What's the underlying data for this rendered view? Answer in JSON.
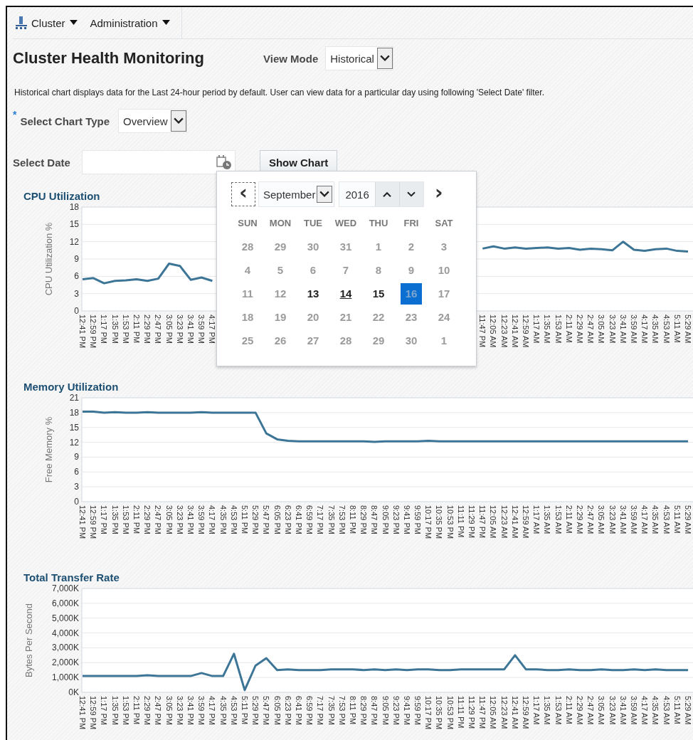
{
  "menu": [
    {
      "label": "Cluster"
    },
    {
      "label": "Administration"
    }
  ],
  "title": "Cluster Health Monitoring",
  "view_mode": {
    "label": "View Mode",
    "value": "Historical"
  },
  "description": "Historical chart displays data for the Last 24-hour period by default. User can view data for a particular day using following 'Select Date' filter.",
  "chart_type": {
    "label": "Select Chart Type",
    "required_mark": "*",
    "value": "Overview"
  },
  "select_date": {
    "label": "Select Date"
  },
  "show_chart_button": "Show Chart",
  "date_picker": {
    "prev": "‹",
    "next": "›",
    "month": "September",
    "year": "2016",
    "weekdays": [
      "SUN",
      "MON",
      "TUE",
      "WED",
      "THU",
      "FRI",
      "SAT"
    ],
    "days": [
      {
        "label": "28",
        "enabled": false,
        "selected": false,
        "hovered": false
      },
      {
        "label": "29",
        "enabled": false,
        "selected": false,
        "hovered": false
      },
      {
        "label": "30",
        "enabled": false,
        "selected": false,
        "hovered": false
      },
      {
        "label": "31",
        "enabled": false,
        "selected": false,
        "hovered": false
      },
      {
        "label": "1",
        "enabled": false,
        "selected": false,
        "hovered": false
      },
      {
        "label": "2",
        "enabled": false,
        "selected": false,
        "hovered": false
      },
      {
        "label": "3",
        "enabled": false,
        "selected": false,
        "hovered": false
      },
      {
        "label": "4",
        "enabled": false,
        "selected": false,
        "hovered": false
      },
      {
        "label": "5",
        "enabled": false,
        "selected": false,
        "hovered": false
      },
      {
        "label": "6",
        "enabled": false,
        "selected": false,
        "hovered": false
      },
      {
        "label": "7",
        "enabled": false,
        "selected": false,
        "hovered": false
      },
      {
        "label": "8",
        "enabled": false,
        "selected": false,
        "hovered": false
      },
      {
        "label": "9",
        "enabled": false,
        "selected": false,
        "hovered": false
      },
      {
        "label": "10",
        "enabled": false,
        "selected": false,
        "hovered": false
      },
      {
        "label": "11",
        "enabled": false,
        "selected": false,
        "hovered": false
      },
      {
        "label": "12",
        "enabled": false,
        "selected": false,
        "hovered": false
      },
      {
        "label": "13",
        "enabled": true,
        "selected": false,
        "hovered": false
      },
      {
        "label": "14",
        "enabled": true,
        "selected": false,
        "hovered": true
      },
      {
        "label": "15",
        "enabled": true,
        "selected": false,
        "hovered": false
      },
      {
        "label": "16",
        "enabled": false,
        "selected": true,
        "hovered": false
      },
      {
        "label": "17",
        "enabled": false,
        "selected": false,
        "hovered": false
      },
      {
        "label": "18",
        "enabled": false,
        "selected": false,
        "hovered": false
      },
      {
        "label": "19",
        "enabled": false,
        "selected": false,
        "hovered": false
      },
      {
        "label": "20",
        "enabled": false,
        "selected": false,
        "hovered": false
      },
      {
        "label": "21",
        "enabled": false,
        "selected": false,
        "hovered": false
      },
      {
        "label": "22",
        "enabled": false,
        "selected": false,
        "hovered": false
      },
      {
        "label": "23",
        "enabled": false,
        "selected": false,
        "hovered": false
      },
      {
        "label": "24",
        "enabled": false,
        "selected": false,
        "hovered": false
      },
      {
        "label": "25",
        "enabled": false,
        "selected": false,
        "hovered": false
      },
      {
        "label": "26",
        "enabled": false,
        "selected": false,
        "hovered": false
      },
      {
        "label": "27",
        "enabled": false,
        "selected": false,
        "hovered": false
      },
      {
        "label": "28",
        "enabled": false,
        "selected": false,
        "hovered": false
      },
      {
        "label": "29",
        "enabled": false,
        "selected": false,
        "hovered": false
      },
      {
        "label": "30",
        "enabled": false,
        "selected": false,
        "hovered": false
      },
      {
        "label": "1",
        "enabled": false,
        "selected": false,
        "hovered": false
      }
    ]
  },
  "charts": [
    {
      "title": "CPU Utilization",
      "chart_data": {
        "type": "line",
        "grid": true,
        "ylabel": "CPU Utilization %",
        "categories": [
          "12:41 PM",
          "12:59 PM",
          "1:17 PM",
          "1:35 PM",
          "1:53 PM",
          "2:11 PM",
          "2:29 PM",
          "2:47 PM",
          "3:05 PM",
          "3:23 PM",
          "3:41 PM",
          "3:59 PM",
          "4:17 PM",
          null,
          null,
          null,
          null,
          null,
          null,
          null,
          null,
          null,
          null,
          null,
          null,
          null,
          null,
          null,
          null,
          null,
          null,
          null,
          null,
          null,
          null,
          null,
          null,
          "11:47 PM",
          "12:05 AM",
          "12:23 AM",
          "12:41 AM",
          "12:59 AM",
          "1:17 AM",
          "1:35 AM",
          "1:53 AM",
          "2:11 AM",
          "2:29 AM",
          "2:47 AM",
          "3:05 AM",
          "3:23 AM",
          "3:41 AM",
          "3:59 AM",
          "4:17 AM",
          "4:35 AM",
          "4:53 AM",
          "5:11 AM",
          "5:29 AM"
        ],
        "series": [
          {
            "color": "#3d7597",
            "values": [
              5.5,
              5.7,
              4.8,
              5.2,
              5.3,
              5.5,
              5.2,
              5.6,
              8.2,
              7.8,
              5.4,
              5.8,
              5.2,
              null,
              null,
              null,
              null,
              null,
              null,
              null,
              null,
              null,
              null,
              null,
              null,
              null,
              null,
              null,
              null,
              null,
              null,
              null,
              null,
              null,
              null,
              null,
              null,
              10.8,
              11.2,
              10.8,
              11,
              10.8,
              10.9,
              11,
              10.8,
              10.9,
              10.6,
              10.8,
              10.7,
              10.5,
              12,
              10.6,
              10.4,
              10.7,
              10.8,
              10.4,
              10.3
            ]
          }
        ],
        "ylim": [
          0,
          18
        ],
        "yticks": [
          0,
          3,
          6,
          9,
          12,
          15,
          18
        ]
      }
    },
    {
      "title": "Memory Utilization",
      "chart_data": {
        "type": "line",
        "grid": true,
        "ylabel": "Free Memory %",
        "categories": [
          "12:41 PM",
          "12:59 PM",
          "1:17 PM",
          "1:35 PM",
          "1:53 PM",
          "2:11 PM",
          "2:29 PM",
          "2:47 PM",
          "3:05 PM",
          "3:23 PM",
          "3:41 PM",
          "3:59 PM",
          "4:17 PM",
          "4:35 PM",
          "4:53 PM",
          "5:11 PM",
          "5:29 PM",
          "5:47 PM",
          "6:05 PM",
          "6:23 PM",
          "6:41 PM",
          "6:59 PM",
          "7:17 PM",
          "7:35 PM",
          "7:53 PM",
          "8:11 PM",
          "8:29 PM",
          "8:47 PM",
          "9:05 PM",
          "9:23 PM",
          "9:41 PM",
          "9:59 PM",
          "10:17 PM",
          "10:35 PM",
          "10:53 PM",
          "11:11 PM",
          "11:29 PM",
          "11:47 PM",
          "12:05 AM",
          "12:23 AM",
          "12:41 AM",
          "12:59 AM",
          "1:17 AM",
          "1:35 AM",
          "1:53 AM",
          "2:11 AM",
          "2:29 AM",
          "2:47 AM",
          "3:05 AM",
          "3:23 AM",
          "3:41 AM",
          "3:59 AM",
          "4:17 AM",
          "4:35 AM",
          "4:53 AM",
          "5:11 AM",
          "5:29 AM"
        ],
        "series": [
          {
            "color": "#3d7597",
            "values": [
              18.2,
              18.2,
              18,
              18.1,
              18,
              18,
              18.1,
              18,
              18,
              18,
              18,
              18.1,
              18,
              18,
              18,
              18,
              18,
              13.8,
              12.6,
              12.3,
              12.2,
              12.2,
              12.2,
              12.2,
              12.2,
              12.2,
              12.2,
              12.1,
              12.2,
              12.2,
              12.2,
              12.2,
              12.3,
              12.2,
              12.2,
              12.2,
              12.2,
              12.2,
              12.2,
              12.2,
              12.2,
              12.2,
              12.2,
              12.2,
              12.2,
              12.2,
              12.2,
              12.2,
              12.2,
              12.2,
              12.2,
              12.2,
              12.2,
              12.2,
              12.2,
              12.2,
              12.2
            ]
          }
        ],
        "ylim": [
          0,
          21
        ],
        "yticks": [
          0,
          3,
          6,
          9,
          12,
          15,
          18,
          21
        ]
      }
    },
    {
      "title": "Total Transfer Rate",
      "chart_data": {
        "type": "line",
        "grid": true,
        "ylabel": "Bytes Per Second",
        "categories": [
          "12:41 PM",
          "12:59 PM",
          "1:17 PM",
          "1:35 PM",
          "1:53 PM",
          "2:11 PM",
          "2:29 PM",
          "2:47 PM",
          "3:05 PM",
          "3:23 PM",
          "3:41 PM",
          "3:59 PM",
          "4:17 PM",
          "4:35 PM",
          "4:53 PM",
          "5:11 PM",
          "5:29 PM",
          "5:47 PM",
          "6:05 PM",
          "6:23 PM",
          "6:41 PM",
          "6:59 PM",
          "7:17 PM",
          "7:35 PM",
          "7:53 PM",
          "8:11 PM",
          "8:29 PM",
          "8:47 PM",
          "9:05 PM",
          "9:23 PM",
          "9:41 PM",
          "9:59 PM",
          "10:17 PM",
          "10:35 PM",
          "10:53 PM",
          "11:11 PM",
          "11:29 PM",
          "11:47 PM",
          "12:05 AM",
          "12:23 AM",
          "12:41 AM",
          "12:59 AM",
          "1:17 AM",
          "1:35 AM",
          "1:53 AM",
          "2:11 AM",
          "2:29 AM",
          "2:47 AM",
          "3:05 AM",
          "3:23 AM",
          "3:41 AM",
          "3:59 AM",
          "4:17 AM",
          "4:35 AM",
          "4:53 AM",
          "5:11 AM",
          "5:29 AM"
        ],
        "series": [
          {
            "color": "#3d7597",
            "values": [
              1100,
              1100,
              1100,
              1100,
              1100,
              1100,
              1150,
              1100,
              1100,
              1100,
              1100,
              1300,
              1100,
              1100,
              2600,
              150,
              1800,
              2300,
              1500,
              1550,
              1500,
              1500,
              1500,
              1550,
              1550,
              1550,
              1500,
              1550,
              1500,
              1550,
              1500,
              1550,
              1550,
              1500,
              1500,
              1550,
              1550,
              1550,
              1550,
              1550,
              2500,
              1550,
              1550,
              1500,
              1500,
              1550,
              1500,
              1500,
              1550,
              1500,
              1500,
              1550,
              1500,
              1550,
              1500,
              1500,
              1500
            ]
          }
        ],
        "ylim": [
          0,
          7000
        ],
        "yticks": [
          {
            "value": 0,
            "label": "0K"
          },
          {
            "value": 1000,
            "label": "1,000K"
          },
          {
            "value": 2000,
            "label": "2,000K"
          },
          {
            "value": 3000,
            "label": "3,000K"
          },
          {
            "value": 4000,
            "label": "4,000K"
          },
          {
            "value": 5000,
            "label": "5,000K"
          },
          {
            "value": 6000,
            "label": "6,000K"
          },
          {
            "value": 7000,
            "label": "7,000K"
          }
        ]
      }
    }
  ]
}
